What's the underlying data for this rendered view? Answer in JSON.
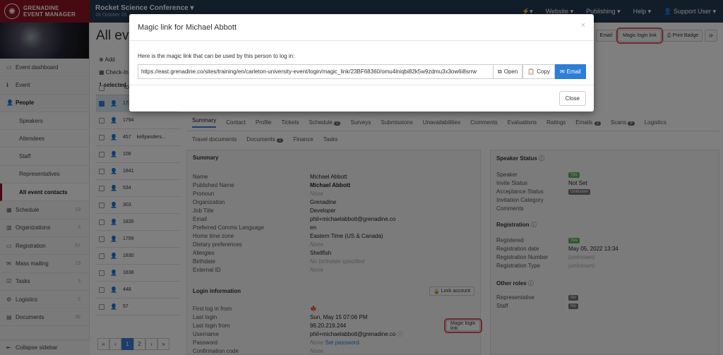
{
  "brand": {
    "line1": "GRENADINE",
    "line2": "EVENT MANAGER"
  },
  "topbar": {
    "conference": "Rocket Science Conference",
    "date": "28 October 20",
    "nav": [
      "Website",
      "Publishing",
      "Help",
      "Support User"
    ]
  },
  "sidebar": {
    "items": [
      {
        "label": "Event dashboard",
        "icon": "monitor-icon",
        "count": ""
      },
      {
        "label": "Event",
        "icon": "info-icon",
        "count": ""
      },
      {
        "label": "People",
        "icon": "person-icon",
        "count": ""
      },
      {
        "label": "Speakers",
        "sub": true
      },
      {
        "label": "Attendees",
        "sub": true
      },
      {
        "label": "Staff",
        "sub": true
      },
      {
        "label": "Representatives",
        "sub": true
      },
      {
        "label": "All event contacts",
        "sub": true,
        "active": true
      },
      {
        "label": "Schedule",
        "icon": "calendar-icon",
        "count": "19"
      },
      {
        "label": "Organizations",
        "icon": "building-icon",
        "count": "3"
      },
      {
        "label": "Registration",
        "icon": "card-icon",
        "count": "57"
      },
      {
        "label": "Mass mailing",
        "icon": "mail-icon",
        "count": "19"
      },
      {
        "label": "Tasks",
        "icon": "check-icon",
        "count": "3"
      },
      {
        "label": "Logistics",
        "icon": "gears-icon",
        "count": "2"
      },
      {
        "label": "Documents",
        "icon": "file-icon",
        "count": "36"
      }
    ],
    "collapse": "Collapse sidebar"
  },
  "main": {
    "title": "All eve",
    "actions": {
      "email": "Email",
      "magic": "Magic login link",
      "badge": "Print Badge"
    },
    "tools": {
      "add": "Add",
      "checkin": "Check-In",
      "selected": "1 selected"
    },
    "table": {
      "header": "ID",
      "rows": [
        {
          "id": "1723",
          "name": "",
          "selected": true
        },
        {
          "id": "1794",
          "name": ""
        },
        {
          "id": "457",
          "name": "kellyanders..."
        },
        {
          "id": "108",
          "name": ""
        },
        {
          "id": "1841",
          "name": ""
        },
        {
          "id": "534",
          "name": ""
        },
        {
          "id": "303",
          "name": ""
        },
        {
          "id": "1835",
          "name": ""
        },
        {
          "id": "1799",
          "name": ""
        },
        {
          "id": "1830",
          "name": ""
        },
        {
          "id": "1838",
          "name": ""
        },
        {
          "id": "448",
          "name": ""
        },
        {
          "id": "57",
          "name": ""
        }
      ]
    },
    "pager": [
      "«",
      "‹",
      "1",
      "2",
      "›",
      "»"
    ]
  },
  "detail": {
    "tabs1": [
      "Summary",
      "Contact",
      "Profile",
      "Tickets",
      "Schedule",
      "Surveys",
      "Submissions",
      "Unavailabilities",
      "Comments",
      "Evaluations",
      "Ratings",
      "Emails",
      "Scans",
      "Logistics"
    ],
    "badges": {
      "schedule": "2",
      "emails": "3",
      "scans": "8",
      "documents": "1"
    },
    "tabs2": [
      "Travel documents",
      "Documents",
      "Finance",
      "Tasks"
    ],
    "summary": {
      "title": "Summary",
      "rows": [
        {
          "k": "Name",
          "v": "Michael Abbott"
        },
        {
          "k": "Published Name",
          "v": "Michael Abbott"
        },
        {
          "k": "Pronoun",
          "v": "None"
        },
        {
          "k": "Organization",
          "v": "Grenadine"
        },
        {
          "k": "Job Title",
          "v": "Developer"
        },
        {
          "k": "Email",
          "v": "phil+michaelabbott@grenadine.co"
        },
        {
          "k": "Preferred Comms Language",
          "v": "en"
        },
        {
          "k": "Home time zone",
          "v": "Eastern Time (US & Canada)"
        },
        {
          "k": "Dietary preferences",
          "v": "None"
        },
        {
          "k": "Allergies",
          "v": "Shellfish"
        },
        {
          "k": "Birthdate",
          "v": "No birthdate specified"
        },
        {
          "k": "External ID",
          "v": "None"
        }
      ]
    },
    "login": {
      "title": "Login information",
      "lock": "Lock account",
      "rows": [
        {
          "k": "First log in from",
          "v": ""
        },
        {
          "k": "Last login",
          "v": "Sun, May 15 07:06 PM"
        },
        {
          "k": "Last login from",
          "v": "96.20.219.244"
        },
        {
          "k": "Username",
          "v": "phil+michaelabbott@grenadine.co"
        },
        {
          "k": "Password",
          "v": "None",
          "link": "Set password"
        },
        {
          "k": "Confirmation code",
          "v": "None"
        }
      ],
      "magic": "Magic login link"
    },
    "speaker": {
      "title": "Speaker Status",
      "rows": [
        {
          "k": "Speaker",
          "v": "Yes",
          "tag": true
        },
        {
          "k": "Invite Status",
          "v": "Not Set"
        },
        {
          "k": "Acceptance Status",
          "v": "Unknown",
          "tag": true,
          "gray": true
        },
        {
          "k": "Invitation Category",
          "v": ""
        },
        {
          "k": "Comments",
          "v": ""
        }
      ]
    },
    "registration": {
      "title": "Registration",
      "rows": [
        {
          "k": "Registered",
          "v": "Yes",
          "tag": true
        },
        {
          "k": "Registration date",
          "v": "May 05, 2022 13:34"
        },
        {
          "k": "Registration Number",
          "v": "(unknown)"
        },
        {
          "k": "Registration Type",
          "v": "(unknown)"
        }
      ]
    },
    "roles": {
      "title": "Other roles",
      "rows": [
        {
          "k": "Representative",
          "v": "No",
          "tag": true,
          "gray": true
        },
        {
          "k": "Staff",
          "v": "No",
          "tag": true,
          "gray": true
        }
      ]
    }
  },
  "modal": {
    "title": "Magic link for Michael Abbott",
    "close": "×",
    "intro": "Here is the magic link that can be used by this person to log in:",
    "link": "https://east.grenadine.co/sites/training/en/carleton-university-event/login/magic_link/23BF68360/omu4lniqbi82k5w9zdmu3x3ow6i8srrw",
    "open": "Open",
    "copy": "Copy",
    "email": "Email",
    "close_btn": "Close"
  }
}
